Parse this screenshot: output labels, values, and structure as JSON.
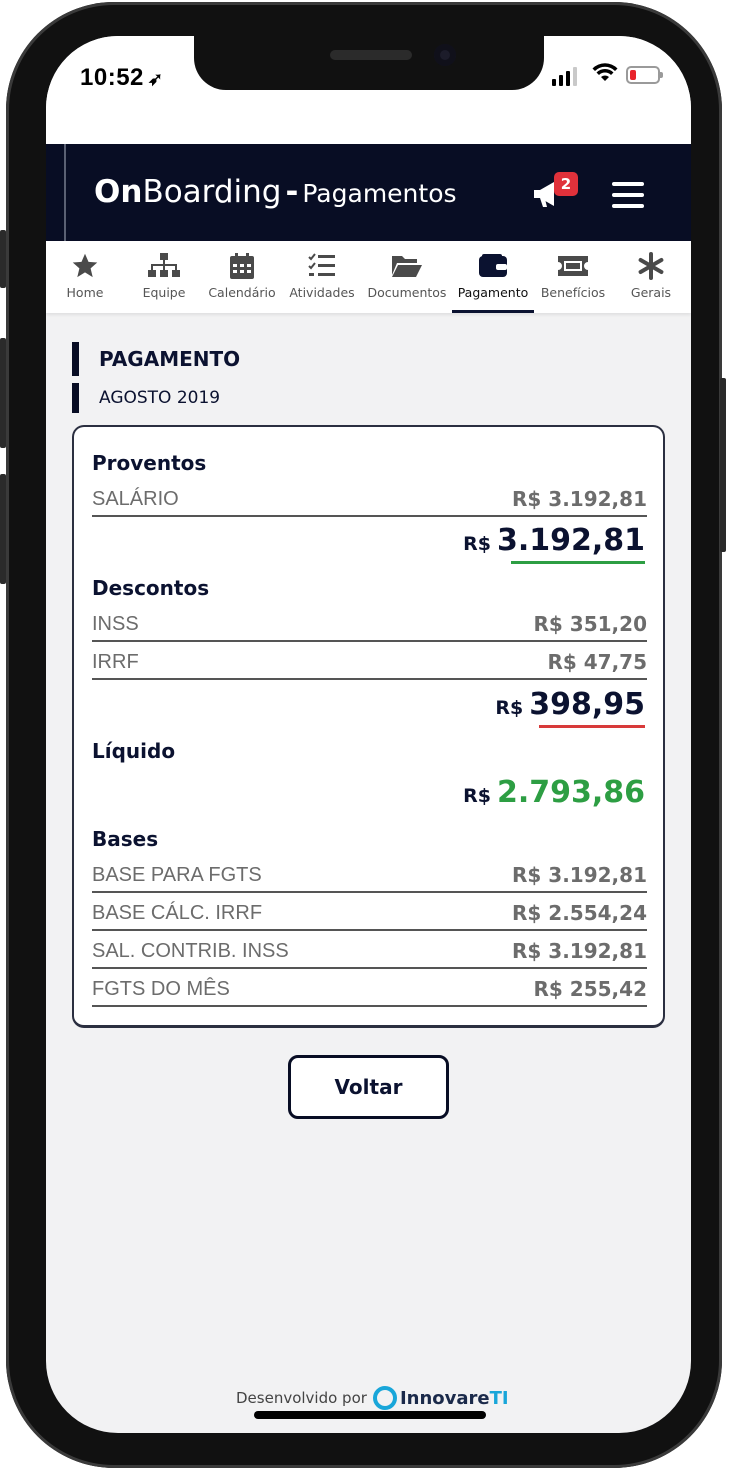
{
  "status_bar": {
    "time": "10:52",
    "location_glyph": "➶"
  },
  "app": {
    "brand_on": "On",
    "brand_boarding": "Boarding",
    "brand_dash": "-",
    "section": "Pagamentos",
    "notification_count": "2",
    "colors": {
      "header_bg": "#080d24",
      "badge": "#e0313b",
      "positive": "#2d9e43",
      "negative": "#d83a3a"
    }
  },
  "tabs": [
    {
      "label": "Home",
      "icon": "star-icon"
    },
    {
      "label": "Equipe",
      "icon": "org-chart-icon"
    },
    {
      "label": "Calendário",
      "icon": "calendar-icon"
    },
    {
      "label": "Atividades",
      "icon": "checklist-icon"
    },
    {
      "label": "Documentos",
      "icon": "folder-open-icon"
    },
    {
      "label": "Pagamento",
      "icon": "wallet-icon",
      "active": true
    },
    {
      "label": "Benefícios",
      "icon": "ticket-icon"
    },
    {
      "label": "Gerais",
      "icon": "asterisk-icon"
    }
  ],
  "page": {
    "title": "PAGAMENTO",
    "period": "AGOSTO 2019"
  },
  "payslip": {
    "proventos": {
      "heading": "Proventos",
      "items": [
        {
          "label": "SALÁRIO",
          "value": "R$ 3.192,81"
        }
      ],
      "total_currency": "R$",
      "total_amount": "3.192,81"
    },
    "descontos": {
      "heading": "Descontos",
      "items": [
        {
          "label": "INSS",
          "value": "R$ 351,20"
        },
        {
          "label": "IRRF",
          "value": "R$ 47,75"
        }
      ],
      "total_currency": "R$",
      "total_amount": "398,95"
    },
    "liquido": {
      "heading": "Líquido",
      "currency": "R$",
      "amount": "2.793,86"
    },
    "bases": {
      "heading": "Bases",
      "items": [
        {
          "label": "BASE PARA FGTS",
          "value": "R$ 3.192,81"
        },
        {
          "label": "BASE CÁLC. IRRF",
          "value": "R$ 2.554,24"
        },
        {
          "label": "SAL. CONTRIB. INSS",
          "value": "R$ 3.192,81"
        },
        {
          "label": "FGTS DO MÊS",
          "value": "R$ 255,42"
        }
      ]
    }
  },
  "actions": {
    "back_label": "Voltar"
  },
  "footer": {
    "developed_by": "Desenvolvido por",
    "company": "Innovare",
    "company_suffix": "TI"
  }
}
